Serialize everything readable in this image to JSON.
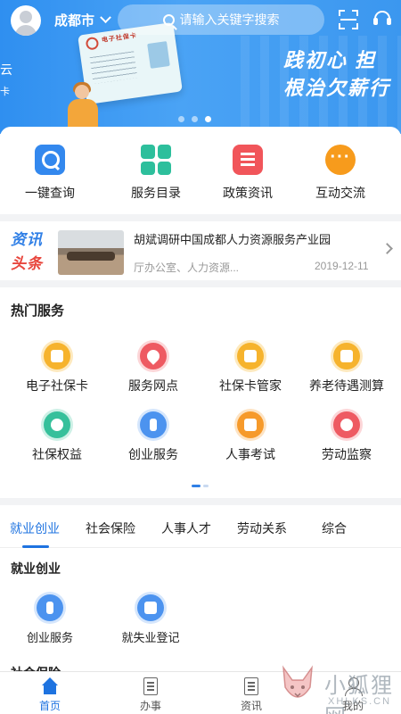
{
  "header": {
    "city": "成都市",
    "search_placeholder": "请输入关键字搜索"
  },
  "banner": {
    "slogan_line1": "践初心  担",
    "slogan_line2": "根治欠薪行",
    "edge_chars": [
      "云",
      "卡"
    ],
    "card_title": "电子社保卡",
    "active_slide": 3,
    "slide_count": 3
  },
  "quick_actions": [
    {
      "label": "一键查询",
      "icon": "search-icon"
    },
    {
      "label": "服务目录",
      "icon": "grid-icon"
    },
    {
      "label": "政策资讯",
      "icon": "book-icon"
    },
    {
      "label": "互动交流",
      "icon": "chat-icon"
    }
  ],
  "news": {
    "tag_line1": "资讯",
    "tag_line2": "头条",
    "title": "胡斌调研中国成都人力资源服务产业园",
    "source": "厅办公室、人力资源...",
    "date": "2019-12-11"
  },
  "hot_services": {
    "title": "热门服务",
    "items": [
      {
        "label": "电子社保卡",
        "icon": "id-card-icon",
        "color": "#f6b32d"
      },
      {
        "label": "服务网点",
        "icon": "location-pin-icon",
        "color": "#ee5a62"
      },
      {
        "label": "社保卡管家",
        "icon": "card-manager-icon",
        "color": "#f6b32d"
      },
      {
        "label": "养老待遇测算",
        "icon": "box-icon",
        "color": "#f6b32d"
      },
      {
        "label": "社保权益",
        "icon": "badge-icon",
        "color": "#36c09b"
      },
      {
        "label": "创业服务",
        "icon": "tie-icon",
        "color": "#4c93ef"
      },
      {
        "label": "人事考试",
        "icon": "exam-icon",
        "color": "#f69a2b"
      },
      {
        "label": "劳动监察",
        "icon": "inspect-icon",
        "color": "#ee5a62"
      }
    ],
    "page": 1,
    "page_count": 2
  },
  "category_tabs": {
    "tabs": [
      "就业创业",
      "社会保险",
      "人事人才",
      "劳动关系",
      "综合"
    ],
    "active": "就业创业"
  },
  "sections": [
    {
      "title": "就业创业",
      "items": [
        {
          "label": "创业服务",
          "icon": "tie-icon"
        },
        {
          "label": "就失业登记",
          "icon": "briefcase-icon"
        }
      ]
    },
    {
      "title": "社会保险",
      "items": []
    }
  ],
  "bottom_nav": [
    {
      "label": "首页",
      "icon": "home-icon",
      "active": true
    },
    {
      "label": "办事",
      "icon": "document-icon",
      "active": false
    },
    {
      "label": "资讯",
      "icon": "news-icon",
      "active": false
    },
    {
      "label": "我的",
      "icon": "user-icon",
      "active": false
    }
  ],
  "watermark": {
    "text": "小狐狸网",
    "url": "XHLKS.CN"
  },
  "colors": {
    "primary": "#1e73e0",
    "banner": "#3b97ef"
  }
}
